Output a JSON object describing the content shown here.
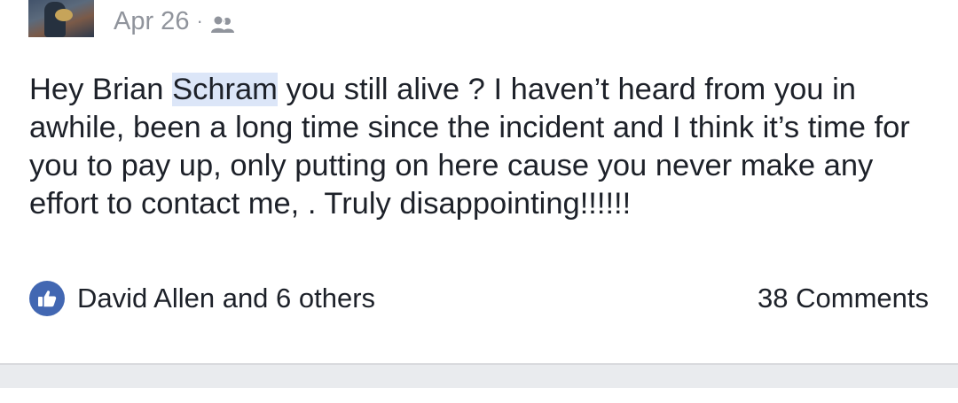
{
  "post": {
    "timestamp": "Apr 26",
    "separator": "·",
    "audience_icon": "friends-icon",
    "message": {
      "before_mention": "Hey Brian ",
      "mention": "Schram",
      "after_mention": " you still alive ? I haven’t heard from you in awhile, been a long time since the incident and I think it’s time for you to pay up, only putting on here cause you never make any effort to contact me, . Truly disappointing!!!!!!"
    },
    "reactions": {
      "icon": "like-icon",
      "summary": "David Allen and 6 others"
    },
    "comments_label": "38 Comments"
  },
  "colors": {
    "like_blue": "#4267b2",
    "meta_gray": "#90949c",
    "mention_highlight": "#dce6f8",
    "feed_background": "#e9ebee"
  }
}
